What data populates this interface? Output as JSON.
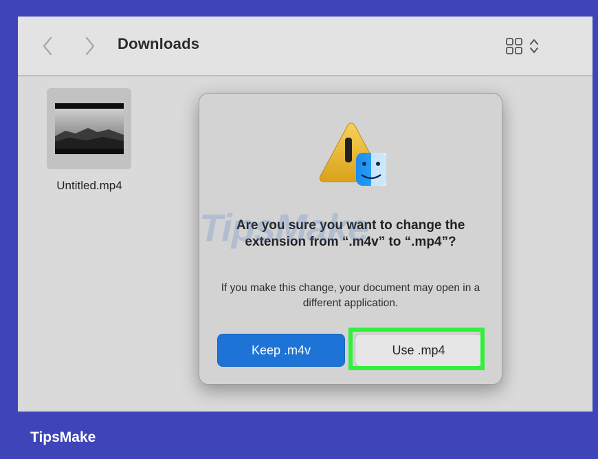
{
  "toolbar": {
    "folder_title": "Downloads",
    "back_icon": "chevron-left-icon",
    "forward_icon": "chevron-right-icon",
    "view_icon": "grid-view-icon",
    "view_toggle_icon": "up-down-chevron-icon"
  },
  "files": [
    {
      "name": "Untitled.mp4",
      "icon": "video-thumbnail"
    }
  ],
  "dialog": {
    "icon": "warning-finder-icon",
    "title": "Are you sure you want to change the extension from “.m4v” to “.mp4”?",
    "message": "If you make this change, your document may open in a different application.",
    "keep_label": "Keep .m4v",
    "use_label": "Use .mp4",
    "highlight_color": "#30f03a"
  },
  "watermark": "TipsMake",
  "brand": "TipsMake",
  "colors": {
    "frame": "#3f45b8",
    "primary_button": "#1e74d6",
    "highlight": "#30f03a"
  }
}
